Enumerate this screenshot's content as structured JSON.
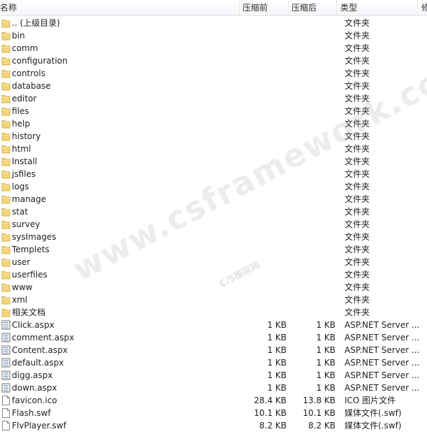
{
  "columns": {
    "name": "名称",
    "compressed": "压缩前",
    "original": "压缩后",
    "type": "类型",
    "extra": "修"
  },
  "files": [
    {
      "name": ".. (上级目录)",
      "csize": "",
      "osize": "",
      "type": "文件夹",
      "icon": "folder-icon"
    },
    {
      "name": "bin",
      "csize": "",
      "osize": "",
      "type": "文件夹",
      "icon": "folder-icon"
    },
    {
      "name": "comm",
      "csize": "",
      "osize": "",
      "type": "文件夹",
      "icon": "folder-icon"
    },
    {
      "name": "configuration",
      "csize": "",
      "osize": "",
      "type": "文件夹",
      "icon": "folder-icon"
    },
    {
      "name": "controls",
      "csize": "",
      "osize": "",
      "type": "文件夹",
      "icon": "folder-icon"
    },
    {
      "name": "database",
      "csize": "",
      "osize": "",
      "type": "文件夹",
      "icon": "folder-icon"
    },
    {
      "name": "editor",
      "csize": "",
      "osize": "",
      "type": "文件夹",
      "icon": "folder-icon"
    },
    {
      "name": "files",
      "csize": "",
      "osize": "",
      "type": "文件夹",
      "icon": "folder-icon"
    },
    {
      "name": "help",
      "csize": "",
      "osize": "",
      "type": "文件夹",
      "icon": "folder-icon"
    },
    {
      "name": "history",
      "csize": "",
      "osize": "",
      "type": "文件夹",
      "icon": "folder-icon"
    },
    {
      "name": "html",
      "csize": "",
      "osize": "",
      "type": "文件夹",
      "icon": "folder-icon"
    },
    {
      "name": "Install",
      "csize": "",
      "osize": "",
      "type": "文件夹",
      "icon": "folder-icon"
    },
    {
      "name": "jsfiles",
      "csize": "",
      "osize": "",
      "type": "文件夹",
      "icon": "folder-icon"
    },
    {
      "name": "logs",
      "csize": "",
      "osize": "",
      "type": "文件夹",
      "icon": "folder-icon"
    },
    {
      "name": "manage",
      "csize": "",
      "osize": "",
      "type": "文件夹",
      "icon": "folder-icon"
    },
    {
      "name": "stat",
      "csize": "",
      "osize": "",
      "type": "文件夹",
      "icon": "folder-icon"
    },
    {
      "name": "survey",
      "csize": "",
      "osize": "",
      "type": "文件夹",
      "icon": "folder-icon"
    },
    {
      "name": "sysImages",
      "csize": "",
      "osize": "",
      "type": "文件夹",
      "icon": "folder-icon"
    },
    {
      "name": "Templets",
      "csize": "",
      "osize": "",
      "type": "文件夹",
      "icon": "folder-icon"
    },
    {
      "name": "user",
      "csize": "",
      "osize": "",
      "type": "文件夹",
      "icon": "folder-icon"
    },
    {
      "name": "userfiles",
      "csize": "",
      "osize": "",
      "type": "文件夹",
      "icon": "folder-icon"
    },
    {
      "name": "www",
      "csize": "",
      "osize": "",
      "type": "文件夹",
      "icon": "folder-icon"
    },
    {
      "name": "xml",
      "csize": "",
      "osize": "",
      "type": "文件夹",
      "icon": "folder-icon"
    },
    {
      "name": "相关文档",
      "csize": "",
      "osize": "",
      "type": "文件夹",
      "icon": "folder-icon"
    },
    {
      "name": "Click.aspx",
      "csize": "1 KB",
      "osize": "1 KB",
      "type": "ASP.NET Server ...",
      "icon": "aspx-file-icon"
    },
    {
      "name": "comment.aspx",
      "csize": "1 KB",
      "osize": "1 KB",
      "type": "ASP.NET Server ...",
      "icon": "aspx-file-icon"
    },
    {
      "name": "Content.aspx",
      "csize": "1 KB",
      "osize": "1 KB",
      "type": "ASP.NET Server ...",
      "icon": "aspx-file-icon"
    },
    {
      "name": "default.aspx",
      "csize": "1 KB",
      "osize": "1 KB",
      "type": "ASP.NET Server ...",
      "icon": "aspx-file-icon"
    },
    {
      "name": "digg.aspx",
      "csize": "1 KB",
      "osize": "1 KB",
      "type": "ASP.NET Server ...",
      "icon": "aspx-file-icon"
    },
    {
      "name": "down.aspx",
      "csize": "1 KB",
      "osize": "1 KB",
      "type": "ASP.NET Server ...",
      "icon": "aspx-file-icon"
    },
    {
      "name": "favicon.ico",
      "csize": "28.4 KB",
      "osize": "13.8 KB",
      "type": "ICO 图片文件",
      "icon": "blank-file-icon"
    },
    {
      "name": "Flash.swf",
      "csize": "10.1 KB",
      "osize": "10.1 KB",
      "type": "媒体文件(.swf)",
      "icon": "blank-file-icon"
    },
    {
      "name": "FlvPlayer.swf",
      "csize": "8.2 KB",
      "osize": "8.2 KB",
      "type": "媒体文件(.swf)",
      "icon": "blank-file-icon"
    }
  ],
  "watermark": {
    "main": "www.csframework.com",
    "sub": "C/S框架网"
  },
  "colors": {
    "folder": "#f4d57a",
    "folder_edge": "#d9b24c",
    "aspx_lines": "#6b8fc2"
  }
}
